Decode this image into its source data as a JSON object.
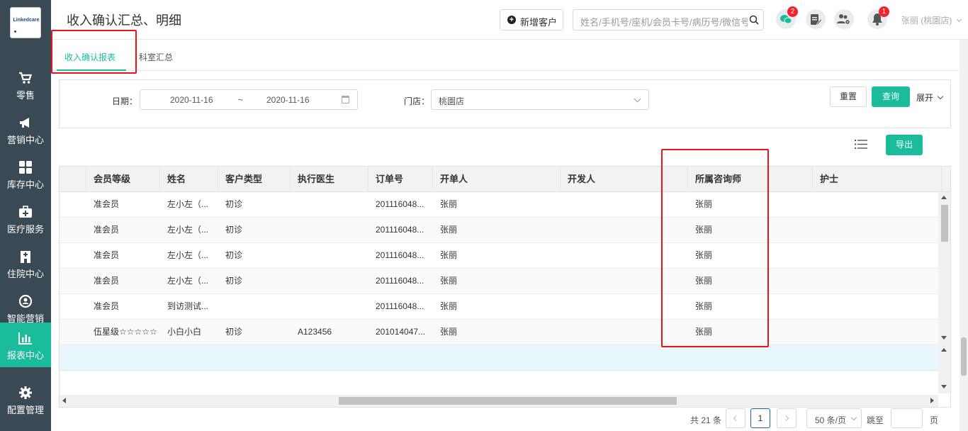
{
  "logo": {
    "text": "Linkedcare"
  },
  "sidebar": {
    "items": [
      {
        "label": "零售",
        "icon": "cart-icon"
      },
      {
        "label": "营销中心",
        "icon": "megaphone-icon"
      },
      {
        "label": "库存中心",
        "icon": "grid-icon"
      },
      {
        "label": "医疗服务",
        "icon": "medical-kit-icon"
      },
      {
        "label": "住院中心",
        "icon": "hospital-building-icon"
      },
      {
        "label": "智能营销",
        "icon": "smart-marketing-icon"
      },
      {
        "label": "报表中心",
        "icon": "bar-chart-icon",
        "active": true
      },
      {
        "label": "配置管理",
        "icon": "gear-icon"
      }
    ]
  },
  "header": {
    "title": "收入确认汇总、明细",
    "new_customer_label": "新增客户",
    "search_placeholder": "姓名/手机号/座机/会员卡号/病历号/微信号",
    "badges": {
      "chat": "2",
      "notifications": "1"
    },
    "user": "张丽 (桃園店)"
  },
  "tabs": [
    {
      "label": "收入确认报表",
      "active": true
    },
    {
      "label": "科室汇总",
      "active": false
    }
  ],
  "filters": {
    "date_label": "日期：",
    "date_start": "2020-11-16",
    "date_separator": "~",
    "date_end": "2020-11-16",
    "store_label": "门店：",
    "store_value": "桃園店",
    "reset_label": "重置",
    "query_label": "查询",
    "expand_label": "展开"
  },
  "toolbar": {
    "export_label": "导出"
  },
  "table": {
    "columns": [
      "会员等级",
      "姓名",
      "客户类型",
      "执行医生",
      "订单号",
      "开单人",
      "开发人",
      "所属咨询师",
      "护士"
    ],
    "rows": [
      [
        "准会员",
        "左小左（...",
        "初诊",
        "",
        "201116048...",
        "张丽",
        "",
        "张丽",
        ""
      ],
      [
        "准会员",
        "左小左（...",
        "初诊",
        "",
        "201116048...",
        "张丽",
        "",
        "张丽",
        ""
      ],
      [
        "准会员",
        "左小左（...",
        "初诊",
        "",
        "201116048...",
        "张丽",
        "",
        "张丽",
        ""
      ],
      [
        "准会员",
        "左小左（...",
        "初诊",
        "",
        "201116048...",
        "张丽",
        "",
        "张丽",
        ""
      ],
      [
        "准会员",
        "到访测试...",
        "",
        "",
        "201116048...",
        "张丽",
        "",
        "张丽",
        ""
      ],
      [
        "伍星级☆☆☆☆☆",
        "小白小白",
        "初诊",
        "A123456",
        "201014047...",
        "张丽",
        "",
        "张丽",
        ""
      ]
    ]
  },
  "pagination": {
    "total": "共 21 条",
    "current_page": "1",
    "page_size": "50 条/页",
    "jump_label": "跳至",
    "page_suffix": "页"
  },
  "colors": {
    "accent": "#1abc9c",
    "sidebar_bg": "#3a4a55",
    "highlight_box": "#e8141b",
    "badge": "#f5222d"
  }
}
